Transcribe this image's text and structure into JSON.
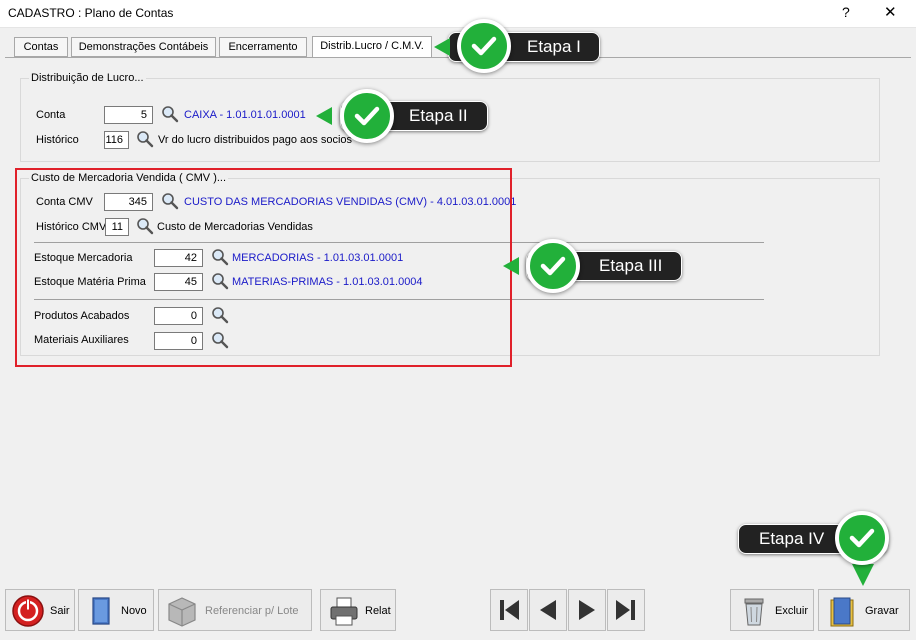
{
  "window": {
    "title": "CADASTRO : Plano de Contas",
    "help": "?",
    "close": "✕"
  },
  "tabs": [
    {
      "label": "Contas"
    },
    {
      "label": "Demonstrações Contábeis"
    },
    {
      "label": "Encerramento"
    },
    {
      "label": "Distrib.Lucro / C.M.V."
    }
  ],
  "lucro": {
    "legend": "Distribuição de Lucro...",
    "conta_label": "Conta",
    "conta_value": "5",
    "conta_desc": "CAIXA - 1.01.01.01.0001",
    "historico_label": "Histórico",
    "historico_value": "116",
    "historico_desc": "Vr do lucro distribuidos pago aos socios"
  },
  "cmv": {
    "legend": "Custo de Mercadoria Vendida ( CMV )...",
    "conta_label": "Conta CMV",
    "conta_value": "345",
    "conta_desc": "CUSTO DAS MERCADORIAS VENDIDAS (CMV) - 4.01.03.01.0001",
    "historico_label": "Histórico CMV",
    "historico_value": "11",
    "historico_desc": "Custo de Mercadorias Vendidas",
    "estoque_merc_label": "Estoque Mercadoria",
    "estoque_merc_value": "42",
    "estoque_merc_desc": "MERCADORIAS - 1.01.03.01.0001",
    "estoque_mp_label": "Estoque Matéria Prima",
    "estoque_mp_value": "45",
    "estoque_mp_desc": "MATERIAS-PRIMAS - 1.01.03.01.0004",
    "prod_acab_label": "Produtos Acabados",
    "prod_acab_value": "0",
    "mat_aux_label": "Materiais Auxiliares",
    "mat_aux_value": "0"
  },
  "callouts": {
    "etapa1": "Etapa I",
    "etapa2": "Etapa II",
    "etapa3": "Etapa III",
    "etapa4": "Etapa IV"
  },
  "toolbar": {
    "sair": "Sair",
    "novo": "Novo",
    "referenciar": "Referenciar p/ Lote",
    "relat": "Relat",
    "excluir": "Excluir",
    "gravar": "Gravar"
  },
  "icons": {
    "search": "magnifier-icon",
    "check": "checkmark-icon"
  },
  "colors": {
    "link": "#1a1ac8",
    "highlight": "#e0202a",
    "callout_bg": "#222222",
    "check_green": "#22b03a"
  }
}
